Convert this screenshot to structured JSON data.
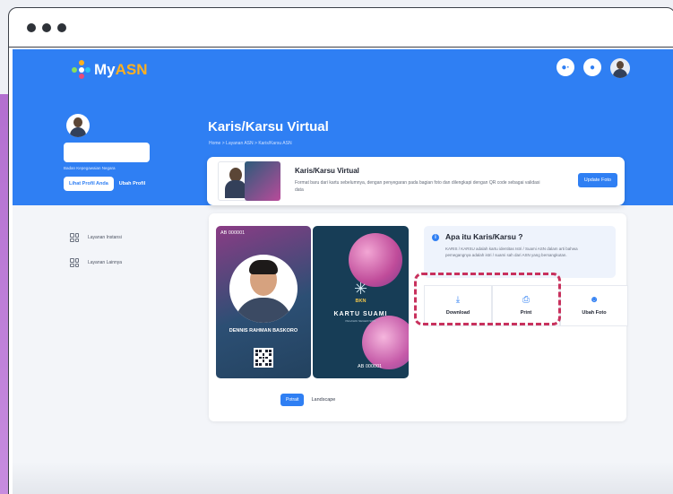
{
  "app": {
    "logo_prefix": "My",
    "logo_suffix": "ASN"
  },
  "colors": {
    "primary": "#2f7ff3",
    "accent": "#ffb01f",
    "highlight": "#c8315d"
  },
  "profile": {
    "agency": "Badan Kepegawaian Negara",
    "view_profile": "Lihat Profil Anda",
    "edit_profile": "Ubah Profil"
  },
  "page": {
    "title": "Karis/Karsu Virtual",
    "breadcrumb": "Home  >  Layanan ASN  >  Karis/Karsu ASN"
  },
  "banner": {
    "title": "Karis/Karsu Virtual",
    "description": "Format baru dari kartu sebelumnya, dengan penyegaran pada bagian foto dan dilengkapi dengan QR code sebagai validasi data",
    "update_button": "Update Foto"
  },
  "sidebar": {
    "items": [
      {
        "label": "Layanan Instansi",
        "icon": "grid-icon"
      },
      {
        "label": "Layanan Lainnya",
        "icon": "grid-icon"
      }
    ]
  },
  "card_front": {
    "code": "AB 000001",
    "name": "DENNIS RAHMAN BASKORO"
  },
  "card_back": {
    "org": "BKN",
    "title": "KARTU SUAMI",
    "subtitle": "PEGAWAI NEGERI SIPIL",
    "code": "AB 000001"
  },
  "orientation": {
    "portrait": "Potrait",
    "landscape": "Landscape"
  },
  "info": {
    "title": "Apa itu Karis/Karsu ?",
    "description": "KARIS / KARSU adalah kartu identitas Istri / Suami ASN dalam arti bahwa pemegangnya adalah istri / suami sah dari ASN yang bersangkutan."
  },
  "actions": [
    {
      "label": "Download",
      "icon": "download-icon",
      "glyph": "⤓"
    },
    {
      "label": "Print",
      "icon": "print-icon",
      "glyph": "⎙"
    },
    {
      "label": "Ubah Foto",
      "icon": "user-icon",
      "glyph": "☻"
    }
  ]
}
